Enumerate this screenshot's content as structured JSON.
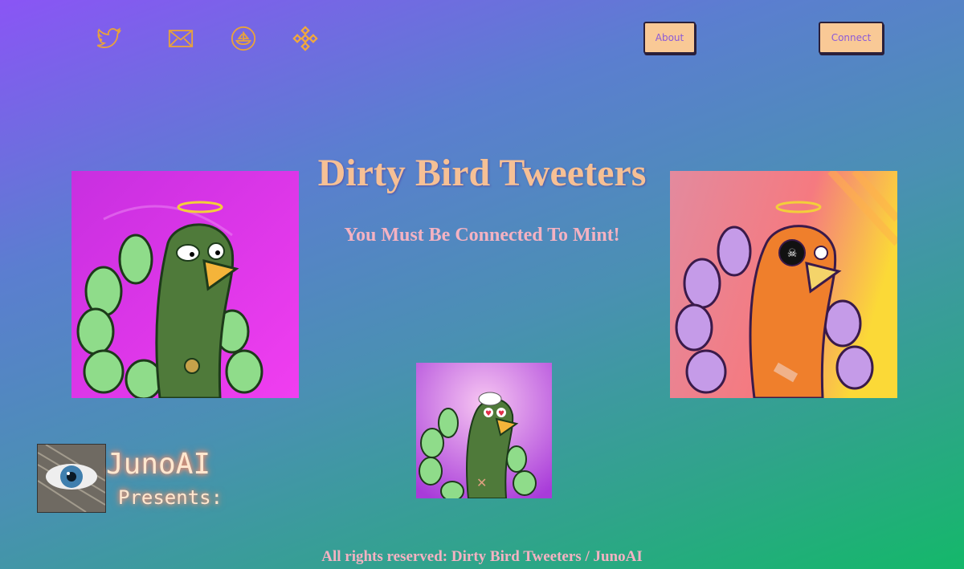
{
  "nav": {
    "icons": [
      "twitter-icon",
      "mail-icon",
      "opensea-icon",
      "binance-icon"
    ],
    "about_label": "About",
    "connect_label": "Connect"
  },
  "hero": {
    "title": "Dirty Bird Tweeters",
    "subtitle": "You Must Be Connected To Mint!"
  },
  "presenter": {
    "name": "JunoAI",
    "tagline": "Presents:"
  },
  "footer": {
    "text": "All rights reserved: Dirty Bird Tweeters / JunoAI"
  },
  "colors": {
    "accent": "#f6c095",
    "button_bg": "#f9c996",
    "button_text": "#8b5ad8",
    "icon": "#f2a93b"
  }
}
